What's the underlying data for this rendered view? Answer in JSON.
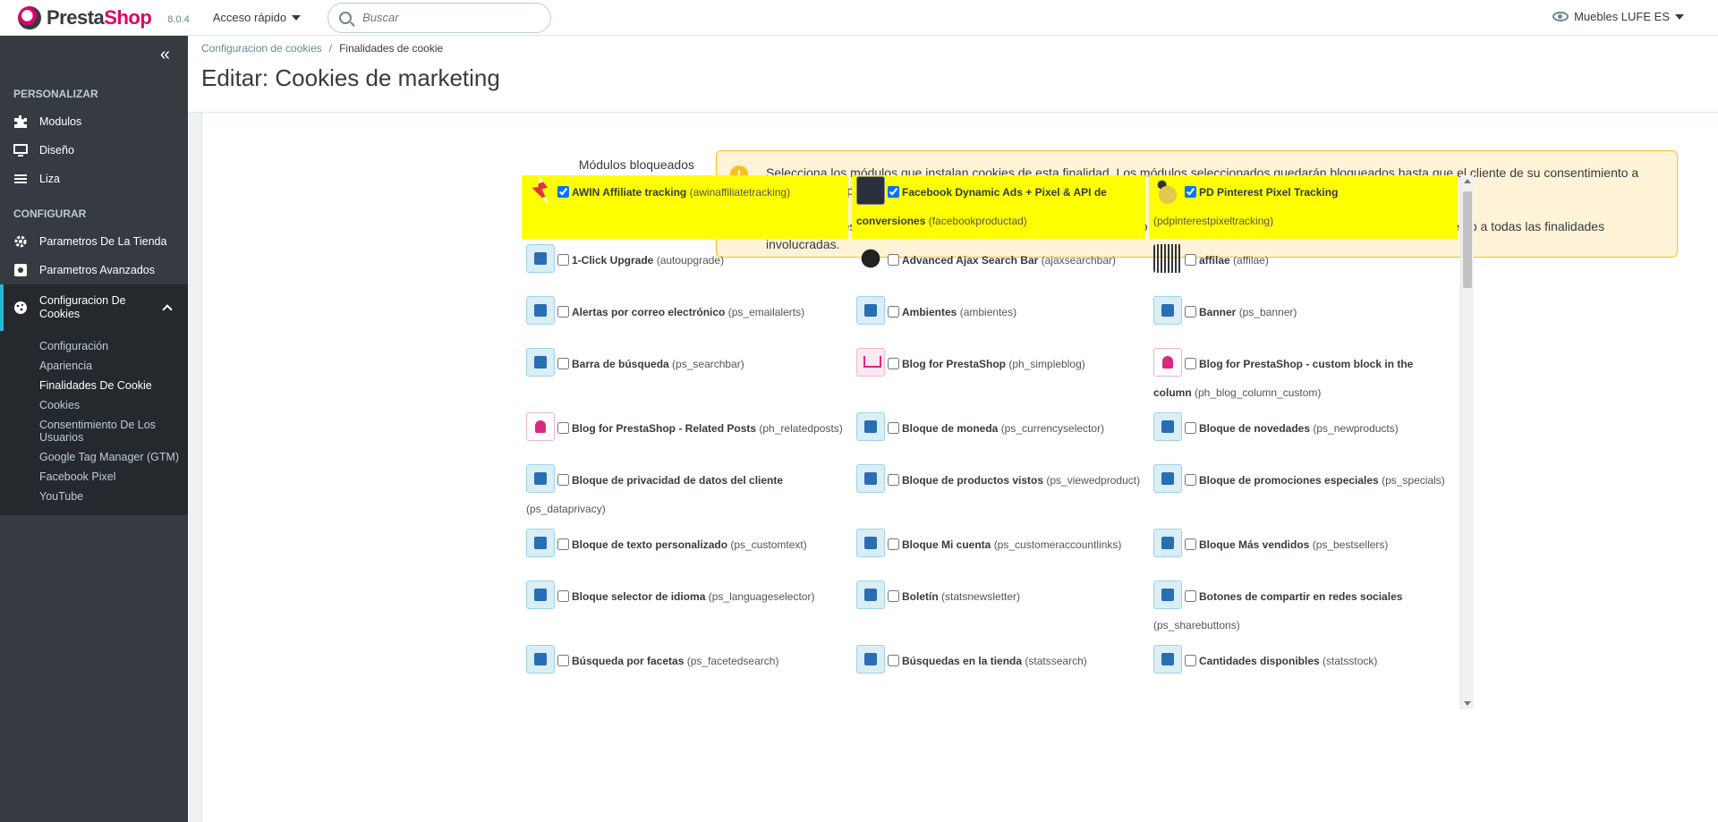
{
  "header": {
    "brand_prefix": "Presta",
    "brand_suffix": "Shop",
    "version": "8.0.4",
    "quick_access": "Acceso rápido",
    "search_placeholder": "Buscar",
    "shop_name": "Muebles LUFE ES",
    "collapse_icon": "«"
  },
  "sidebar": {
    "sections": [
      {
        "title": "PERSONALIZAR"
      },
      {
        "title": "CONFIGURAR"
      }
    ],
    "personalizar_items": [
      {
        "label": "Modulos",
        "icon": "puzzle-icon"
      },
      {
        "label": "Diseño",
        "icon": "monitor-icon"
      },
      {
        "label": "Liza",
        "icon": "list-icon"
      }
    ],
    "configurar_items": [
      {
        "label": "Parametros De La Tienda",
        "icon": "gear-icon"
      },
      {
        "label": "Parametros Avanzados",
        "icon": "settings-box-icon"
      },
      {
        "label": "Configuracion De Cookies",
        "icon": "cookie-icon"
      }
    ],
    "submenu": [
      "Configuración",
      "Apariencia",
      "Finalidades De Cookie",
      "Cookies",
      "Consentimiento De Los Usuarios",
      "Google Tag Manager (GTM)",
      "Facebook Pixel",
      "YouTube"
    ]
  },
  "page": {
    "breadcrumb": [
      "Configuracion de cookies",
      "/",
      "Finalidades de cookie"
    ],
    "title": "Editar: Cookies de marketing"
  },
  "form": {
    "label": "Módulos bloqueados",
    "alert_icon": "!",
    "alert_p1": "Selecciona los módulos que instalan cookies de esta finalidad. Los módulos seleccionados quedarán bloqueados hasta que el cliente de su consentimiento a esta finalidad, por lo que el módulo no podrá instalar las cookies.",
    "alert_p2": "Si un módulo es seleccionado en más de una finalidad, el módulo no se desbloqueará hasta que el cliente de su consentimiento a todas las finalidades involucradas."
  },
  "modules": [
    {
      "name": "AWIN Affiliate tracking",
      "tech": "(awinaffiliatetracking)",
      "checked": true,
      "icon": "awin-icon"
    },
    {
      "name": "Facebook Dynamic Ads + Pixel & API de conversiones",
      "tech": "(facebookproductad)",
      "checked": true,
      "icon": "facebook-ads-icon"
    },
    {
      "name": "PD Pinterest Pixel Tracking",
      "tech": "(pdpinterestpixeltracking)",
      "checked": true,
      "icon": "pinterest-icon"
    },
    {
      "name": "1-Click Upgrade",
      "tech": "(autoupgrade)",
      "checked": false,
      "icon": "upgrade-icon"
    },
    {
      "name": "Advanced Ajax Search Bar",
      "tech": "(ajaxsearchbar)",
      "checked": false,
      "icon": "ajax-search-icon"
    },
    {
      "name": "affilae",
      "tech": "(affilae)",
      "checked": false,
      "icon": "affilae-icon"
    },
    {
      "name": "Alertas por correo electrónico",
      "tech": "(ps_emailalerts)",
      "checked": false,
      "icon": "email-alert-icon"
    },
    {
      "name": "Ambientes",
      "tech": "(ambientes)",
      "checked": false,
      "icon": "ambientes-icon"
    },
    {
      "name": "Banner",
      "tech": "(ps_banner)",
      "checked": false,
      "icon": "banner-icon"
    },
    {
      "name": "Barra de búsqueda",
      "tech": "(ps_searchbar)",
      "checked": false,
      "icon": "search-bar-icon"
    },
    {
      "name": "Blog for PrestaShop",
      "tech": "(ph_simpleblog)",
      "checked": false,
      "icon": "blog-cart-icon"
    },
    {
      "name": "Blog for PrestaShop - custom block in the column",
      "tech": "(ph_blog_column_custom)",
      "checked": false,
      "icon": "blog-block-icon"
    },
    {
      "name": "Blog for PrestaShop - Related Posts",
      "tech": "(ph_relatedposts)",
      "checked": false,
      "icon": "blog-related-icon"
    },
    {
      "name": "Bloque de moneda",
      "tech": "(ps_currencyselector)",
      "checked": false,
      "icon": "currency-icon"
    },
    {
      "name": "Bloque de novedades",
      "tech": "(ps_newproducts)",
      "checked": false,
      "icon": "new-products-icon"
    },
    {
      "name": "Bloque de privacidad de datos del cliente",
      "tech": "(ps_dataprivacy)",
      "checked": false,
      "icon": "data-privacy-icon"
    },
    {
      "name": "Bloque de productos vistos",
      "tech": "(ps_viewedproduct)",
      "checked": false,
      "icon": "viewed-product-icon"
    },
    {
      "name": "Bloque de promociones especiales",
      "tech": "(ps_specials)",
      "checked": false,
      "icon": "specials-icon"
    },
    {
      "name": "Bloque de texto personalizado",
      "tech": "(ps_customtext)",
      "checked": false,
      "icon": "custom-text-icon"
    },
    {
      "name": "Bloque Mi cuenta",
      "tech": "(ps_customeraccountlinks)",
      "checked": false,
      "icon": "account-icon"
    },
    {
      "name": "Bloque Más vendidos",
      "tech": "(ps_bestsellers)",
      "checked": false,
      "icon": "bestsellers-icon"
    },
    {
      "name": "Bloque selector de idioma",
      "tech": "(ps_languageselector)",
      "checked": false,
      "icon": "language-icon"
    },
    {
      "name": "Boletín",
      "tech": "(statsnewsletter)",
      "checked": false,
      "icon": "newsletter-icon"
    },
    {
      "name": "Botones de compartir en redes sociales",
      "tech": "(ps_sharebuttons)",
      "checked": false,
      "icon": "share-icon"
    },
    {
      "name": "Búsqueda por facetas",
      "tech": "(ps_facetedsearch)",
      "checked": false,
      "icon": "faceted-search-icon"
    },
    {
      "name": "Búsquedas en la tienda",
      "tech": "(statssearch)",
      "checked": false,
      "icon": "store-search-icon"
    },
    {
      "name": "Cantidades disponibles",
      "tech": "(statsstock)",
      "checked": false,
      "icon": "stock-icon"
    }
  ],
  "colors": {
    "accent": "#25b9d7",
    "brand": "#df0067",
    "highlight": "#ffff00",
    "alert_bg": "#fff3d7",
    "alert_border": "#fcbf1e",
    "sidebar_bg": "#363a41"
  }
}
